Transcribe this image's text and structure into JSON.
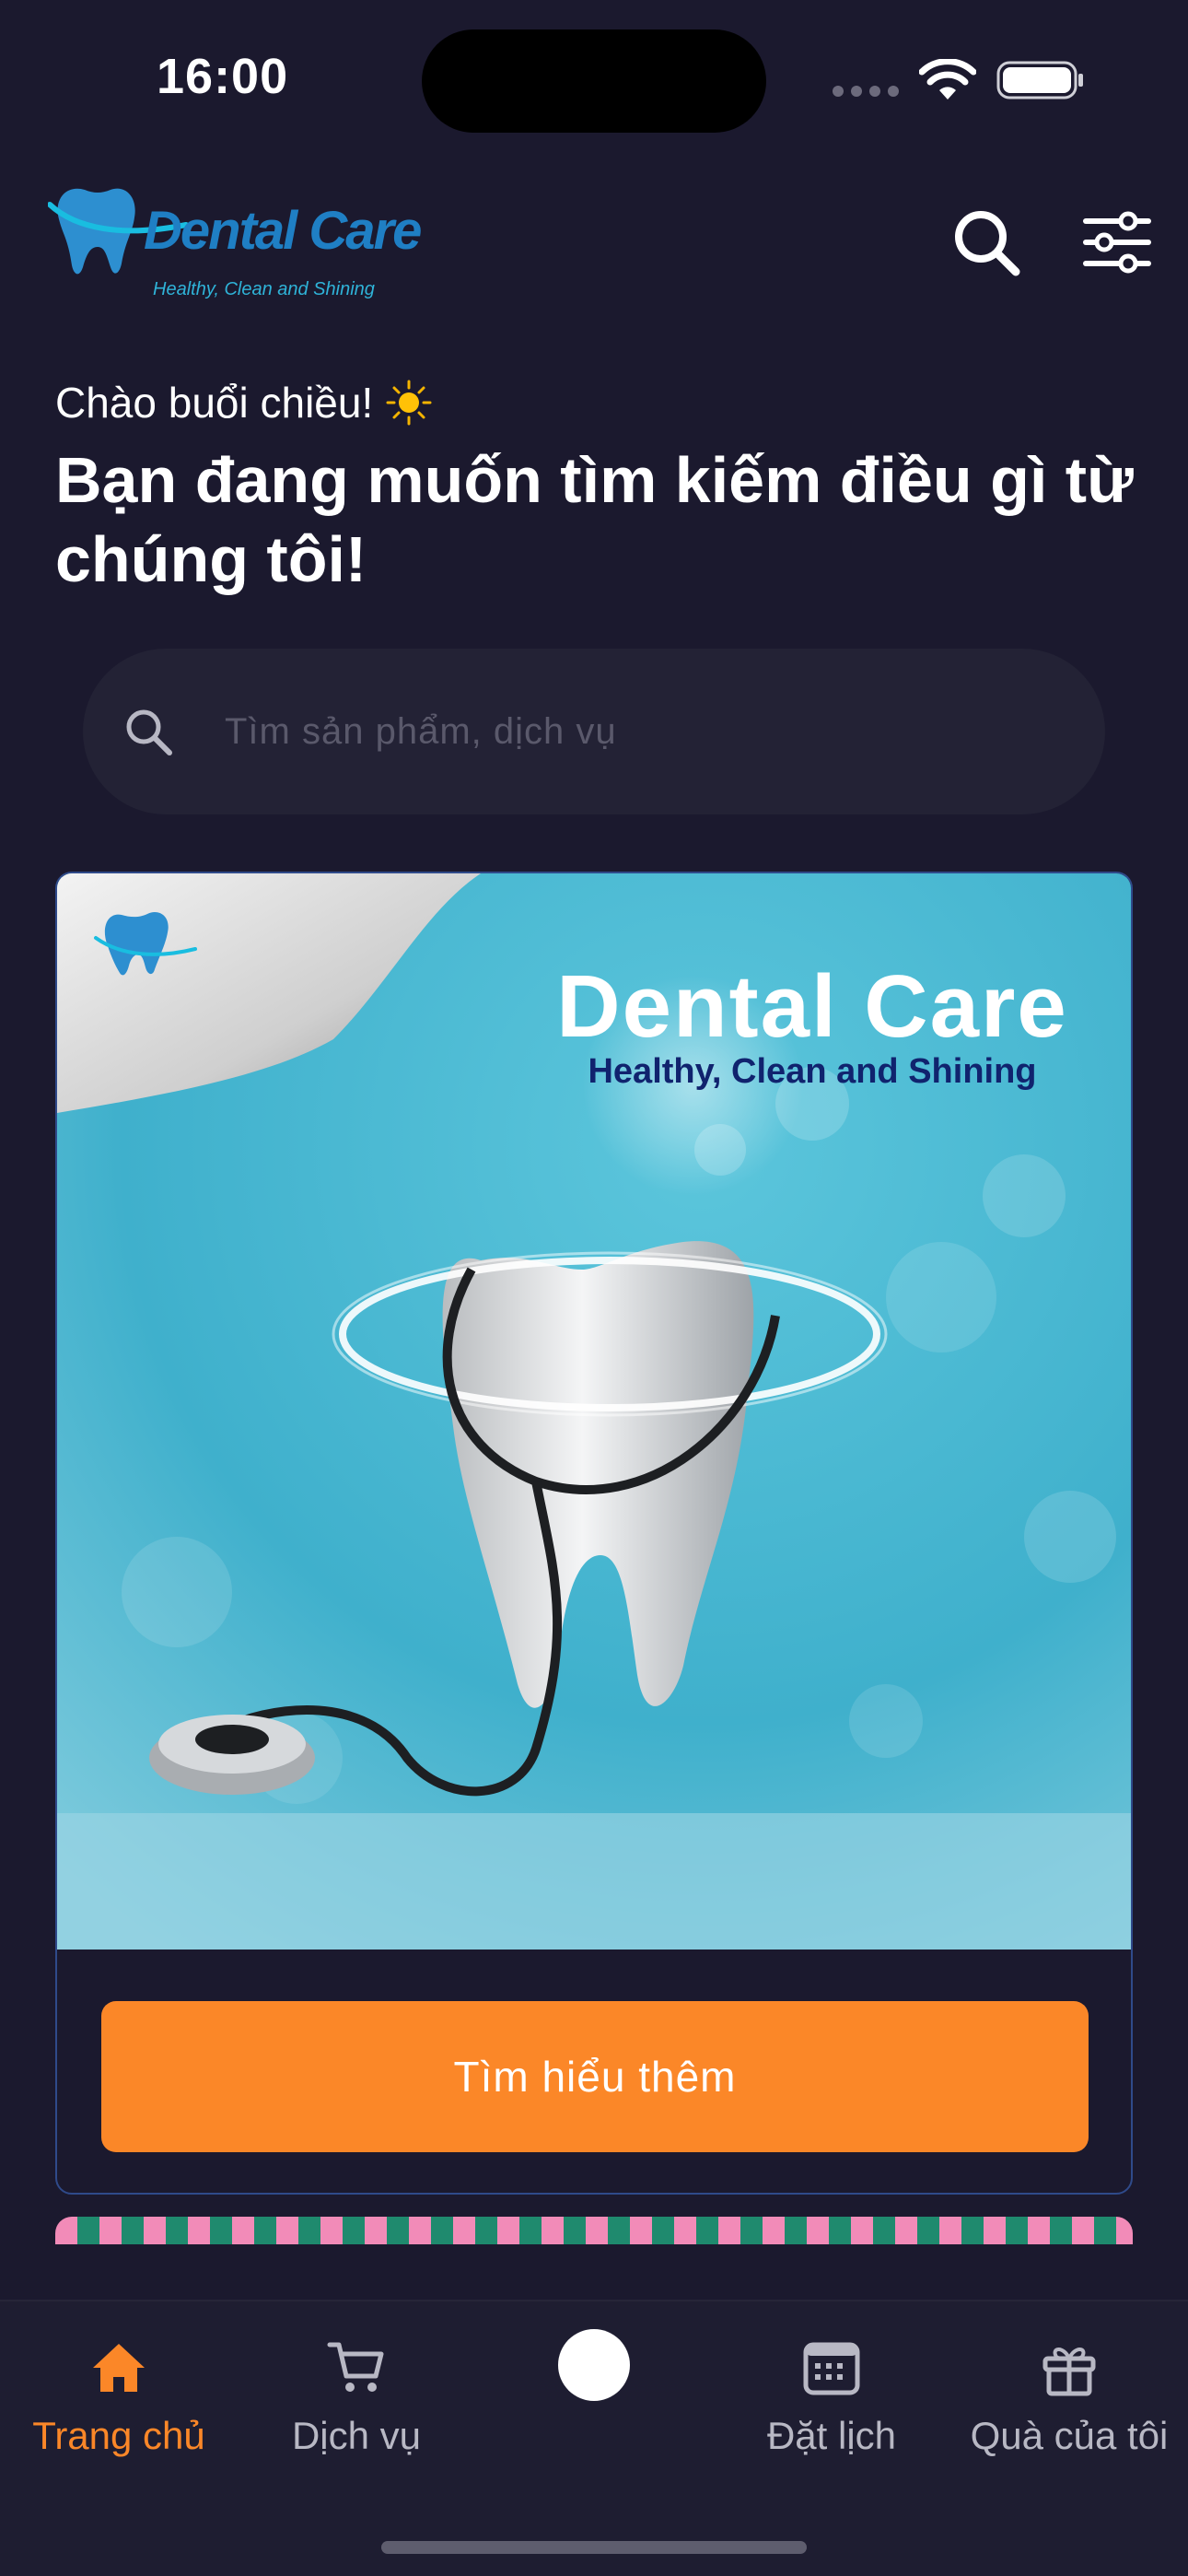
{
  "status_bar": {
    "time": "16:00"
  },
  "header": {
    "logo_name": "Dental Care",
    "logo_tagline": "Healthy, Clean and Shining",
    "search_icon": "search-icon",
    "filter_icon": "sliders-icon"
  },
  "greeting": {
    "subtitle": "Chào buổi chiều!",
    "title": "Bạn đang muốn tìm kiếm điều gì từ chúng tôi!"
  },
  "search": {
    "placeholder": "Tìm sản phẩm, dịch vụ"
  },
  "banner": {
    "title": "Dental Care",
    "subtitle": "Healthy, Clean and Shining",
    "cta_label": "Tìm hiểu thêm"
  },
  "tabbar": {
    "items": [
      {
        "label": "Trang chủ",
        "icon": "home-icon",
        "active": true
      },
      {
        "label": "Dịch vụ",
        "icon": "cart-icon",
        "active": false
      },
      {
        "label": "",
        "icon": "center-dot",
        "active": false
      },
      {
        "label": "Đặt lịch",
        "icon": "calendar-icon",
        "active": false
      },
      {
        "label": "Quà của tôi",
        "icon": "gift-icon",
        "active": false
      }
    ]
  },
  "colors": {
    "background": "#1b192e",
    "accent": "#fb8728",
    "brand_blue": "#2d8fd0",
    "search_bg": "#232235"
  }
}
